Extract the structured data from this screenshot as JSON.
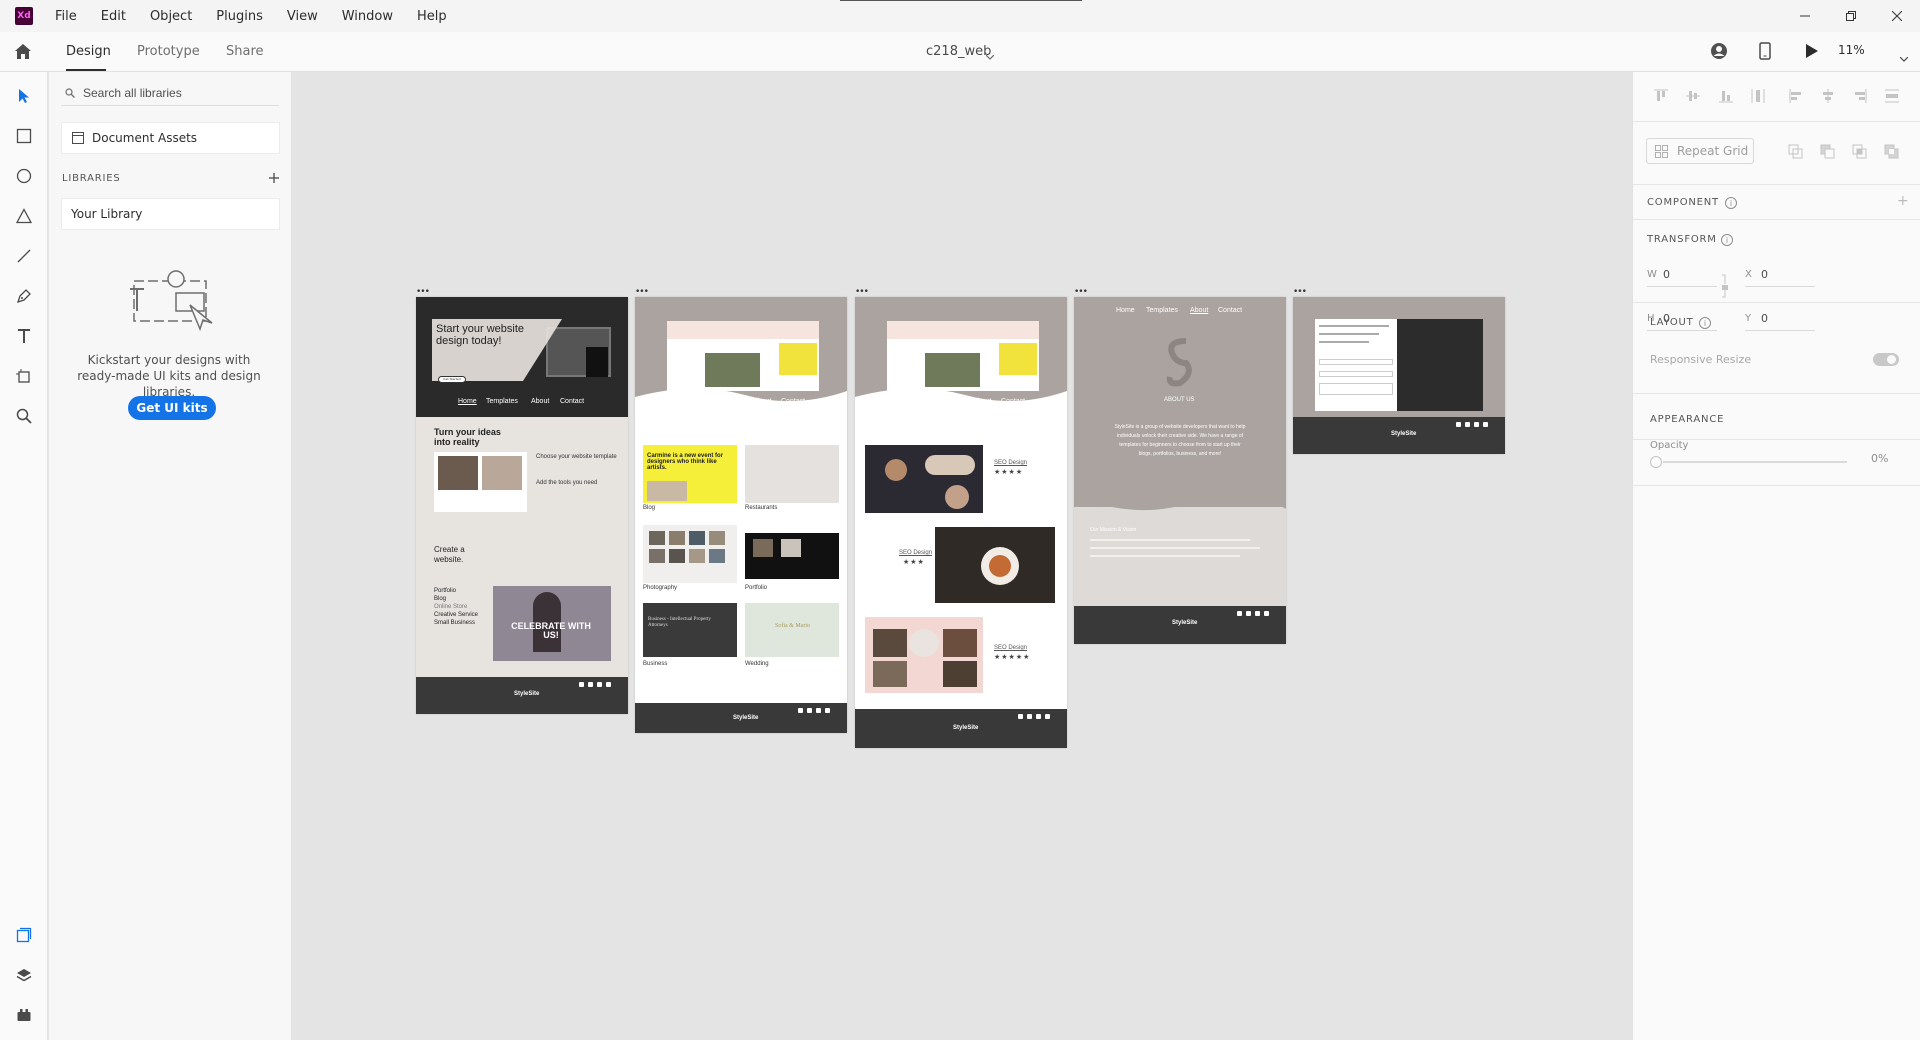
{
  "app": {
    "logo_text": "Xd",
    "menu": [
      "File",
      "Edit",
      "Object",
      "Plugins",
      "View",
      "Window",
      "Help"
    ]
  },
  "toolbar": {
    "tabs": [
      "Design",
      "Prototype",
      "Share"
    ],
    "active_tab": "Design",
    "document_title": "c218_web",
    "zoom": "11%"
  },
  "tools": [
    "select-tool",
    "rectangle-tool",
    "ellipse-tool",
    "polygon-tool",
    "line-tool",
    "pen-tool",
    "text-tool",
    "artboard-tool",
    "zoom-tool"
  ],
  "bottom_tools": [
    "assets-panel",
    "layers-panel",
    "plugins-panel"
  ],
  "libraries": {
    "search_placeholder": "Search all libraries",
    "document_assets": "Document Assets",
    "heading": "LIBRARIES",
    "your_library": "Your Library",
    "kickstart_text": "Kickstart your designs with ready-made UI kits and design libraries.",
    "get_ui_kits": "Get UI kits"
  },
  "inspector": {
    "repeat_grid": "Repeat Grid",
    "component_heading": "COMPONENT",
    "transform_heading": "TRANSFORM",
    "w_label": "W",
    "w_value": "0",
    "h_label": "H",
    "h_value": "0",
    "x_label": "X",
    "x_value": "0",
    "y_label": "Y",
    "y_value": "0",
    "layout_heading": "LAYOUT",
    "responsive_resize": "Responsive Resize",
    "appearance_heading": "APPEARANCE",
    "opacity_label": "Opacity",
    "opacity_value": "0%"
  },
  "artboards": {
    "home": {
      "hero_title": "Start your website design today!",
      "hero_button": "Get Started",
      "nav": [
        "Home",
        "Templates",
        "About",
        "Contact"
      ],
      "section_title": "Turn your ideas into reality",
      "step1": "Choose your website template",
      "step2": "Add the tools you need",
      "create_title": "Create a website.",
      "categories": [
        "Portfolio",
        "Blog",
        "Online Store",
        "Creative Service",
        "Small Business"
      ],
      "celebrate": "CELEBRATE WITH US!",
      "footer_logo": "StyleSite"
    },
    "templates": {
      "nav": [
        "Home",
        "Templates",
        "About",
        "Contact"
      ],
      "featured_text": "Carmine is a new event for designers who think like artists.",
      "labels": [
        "Blog",
        "Restaurants",
        "Photography",
        "Portfolio",
        "Business",
        "Wedding"
      ],
      "business_text": "Business - Intellectual Property Attorneys",
      "wedding_text": "Sofia & Mario",
      "footer_logo": "StyleSite"
    },
    "templates_detail": {
      "nav": [
        "Home",
        "Templates",
        "About",
        "Contact"
      ],
      "labels": [
        "SEO Design",
        "SEO Design",
        "SEO Design"
      ],
      "footer_logo": "StyleSite"
    },
    "about": {
      "nav": [
        "Home",
        "Templates",
        "About",
        "Contact"
      ],
      "heading": "ABOUT US",
      "body": "StyleSite is a group of website developers that want to help individuals unlock their creative side. We have a range of templates for beginners to choose from to start up their blogs, portfolios, business, and more!",
      "subheading": "Our Mission & Vision",
      "footer_logo": "StyleSite"
    },
    "contact": {
      "footer_logo": "StyleSite"
    }
  },
  "colors": {
    "accent": "#1473e6",
    "xd_brand": "#470137",
    "footer_dark": "#393939",
    "taupe": "#aaa3a0"
  }
}
